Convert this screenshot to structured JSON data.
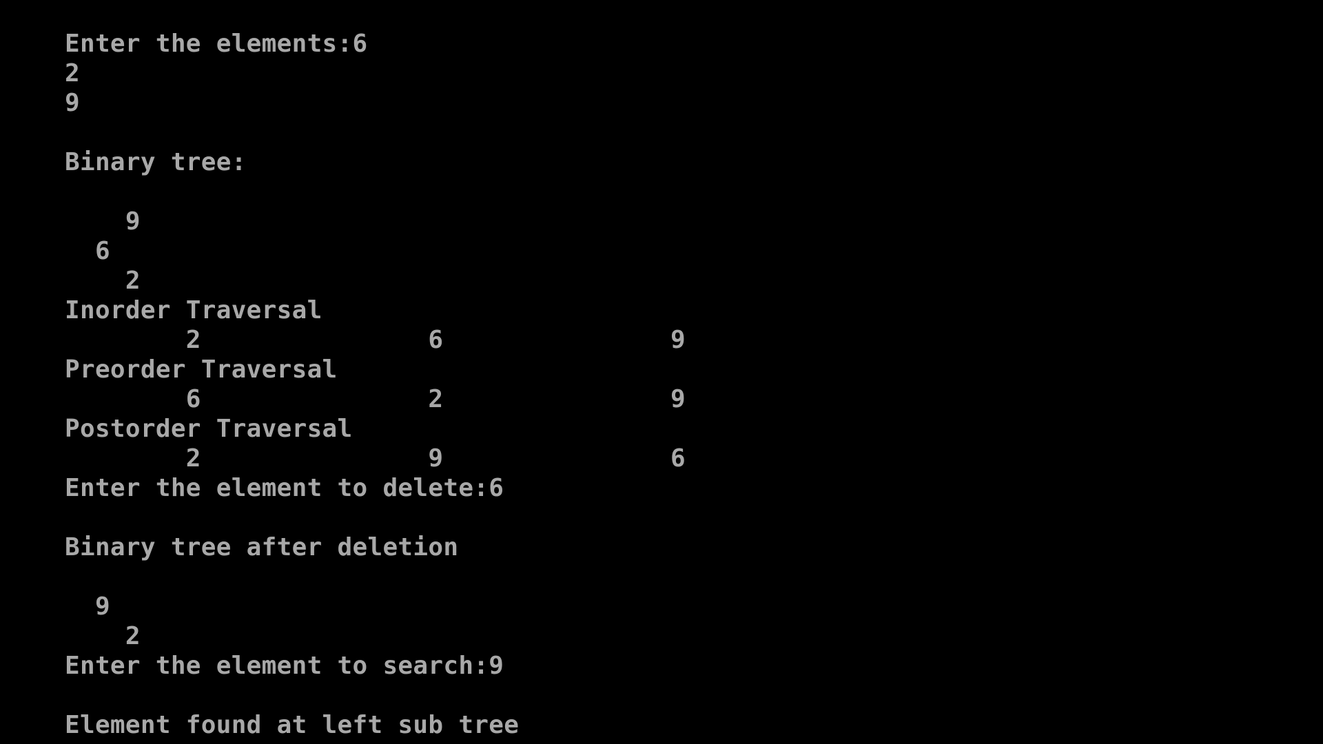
{
  "console": {
    "lines": [
      "Enter the elements:6",
      "2",
      "9",
      "",
      "Binary tree:",
      "",
      "    9",
      "  6",
      "    2",
      "Inorder Traversal",
      "        2               6               9",
      "Preorder Traversal",
      "        6               2               9",
      "Postorder Traversal",
      "        2               9               6",
      "Enter the element to delete:6",
      "",
      "Binary tree after deletion",
      "",
      "  9",
      "    2",
      "Enter the element to search:9",
      "",
      "Element found at left sub tree"
    ]
  },
  "colors": {
    "background": "#000000",
    "text": "#a8a8a8"
  }
}
